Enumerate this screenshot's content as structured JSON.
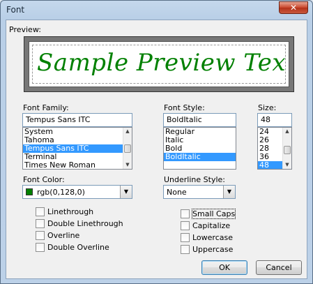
{
  "window": {
    "title": "Font",
    "close_glyph": "✕"
  },
  "preview": {
    "label": "Preview:",
    "text": "Sample Preview Text"
  },
  "font_family": {
    "label": "Font Family:",
    "value": "Tempus Sans ITC",
    "items": [
      "System",
      "Tahoma",
      "Tempus Sans ITC",
      "Terminal",
      "Times New Roman"
    ],
    "selected_index": 2
  },
  "font_style": {
    "label": "Font Style:",
    "value": "BoldItalic",
    "items": [
      "Regular",
      "Italic",
      "Bold",
      "BoldItalic"
    ],
    "selected_index": 3
  },
  "size": {
    "label": "Size:",
    "value": "48",
    "items": [
      "24",
      "26",
      "28",
      "36",
      "48"
    ],
    "selected_index": 4
  },
  "font_color": {
    "label": "Font Color:",
    "value": "rgb(0,128,0)",
    "swatch": "#008000"
  },
  "underline_style": {
    "label": "Underline Style:",
    "value": "None"
  },
  "effects_left": [
    "Linethrough",
    "Double Linethrough",
    "Overline",
    "Double Overline"
  ],
  "effects_right": [
    "Small Caps",
    "Capitalize",
    "Lowercase",
    "Uppercase"
  ],
  "buttons": {
    "ok": "OK",
    "cancel": "Cancel"
  },
  "icons": {
    "dropdown": "▼",
    "scroll_up": "▲",
    "scroll_down": "▼"
  },
  "colors": {
    "preview_text": "#008000",
    "selection": "#3399ff"
  }
}
